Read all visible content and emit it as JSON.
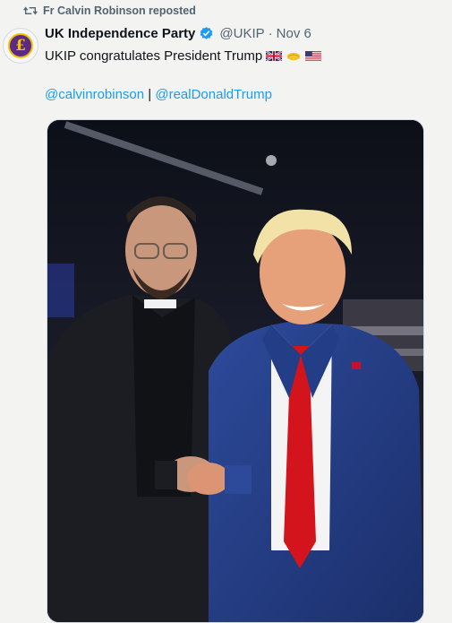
{
  "repost": {
    "icon": "repost-icon",
    "text": "Fr Calvin Robinson reposted"
  },
  "author": {
    "avatar_glyph": "£",
    "name": "UK Independence Party",
    "verified_icon": "verified-badge-icon",
    "handle": "@UKIP",
    "separator": "·",
    "date": "Nov 6"
  },
  "tweet": {
    "text": "UKIP congratulates President Trump",
    "emojis": [
      "uk-flag-icon",
      "handshake-icon",
      "us-flag-icon"
    ],
    "mentions": [
      "@calvinrobinson",
      "@realDonaldTrump"
    ],
    "mention_separator": " | "
  },
  "media": {
    "type": "photo"
  },
  "colors": {
    "link": "#1d9bf0",
    "muted": "#536471",
    "verified": "#1d9bf0",
    "avatar_bg": "#5b2a86",
    "avatar_accent": "#f2c200"
  }
}
